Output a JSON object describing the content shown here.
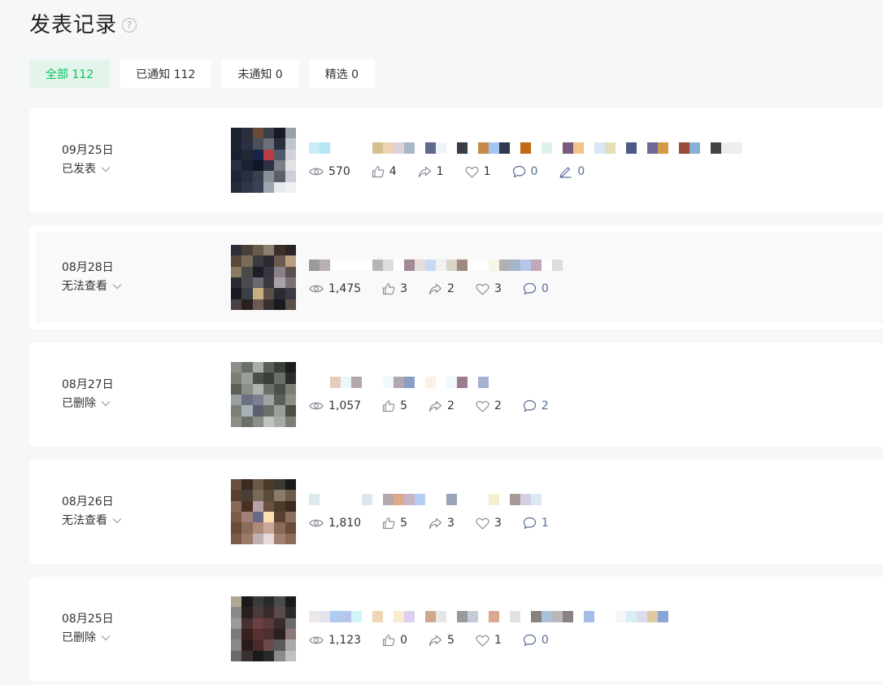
{
  "header": {
    "title": "发表记录",
    "help_glyph": "?"
  },
  "tabs": [
    {
      "label": "全部 112",
      "active": true
    },
    {
      "label": "已通知 112",
      "active": false
    },
    {
      "label": "未通知 0",
      "active": false
    },
    {
      "label": "精选 0",
      "active": false
    }
  ],
  "posts": [
    {
      "date": "09月25日",
      "status": "已发表",
      "stats": {
        "views": "570",
        "likes": "4",
        "shares": "1",
        "favorites": "1",
        "comments": "0",
        "notes": "0"
      },
      "thumb_colors": [
        "#1e2230",
        "#2a2f3c",
        "#6b4a3a",
        "#3a3f4a",
        "#151a24",
        "#9aa0aa",
        "#1e2230",
        "#2c3140",
        "#4a4f5a",
        "#6a6f7a",
        "#2a2f3c",
        "#c0c4cc",
        "#1b2030",
        "#232836",
        "#18214a",
        "#b83c40",
        "#505a6a",
        "#d0d4da",
        "#2a3040",
        "#1d2232",
        "#101528",
        "#2c3144",
        "#7a7f88",
        "#e0e2e6",
        "#20253a",
        "#2a2f40",
        "#3a3f50",
        "#8a8f98",
        "#5a5f6a",
        "#ccd0d6",
        "#262b38",
        "#30354a",
        "#3a4055",
        "#a0a5ae",
        "#e8eaee",
        "#f0f1f3"
      ],
      "title_colors": [
        "#c8eef7",
        "#b6e6f3",
        "#ffffff",
        "#ffffff",
        "#ffffff",
        "#ffffff",
        "#d6c08e",
        "#efd2b4",
        "#dcd2d8",
        "#a6b8c6",
        "#ffffff",
        "#5e6a8e",
        "#f1f4f6",
        "#ffffff",
        "#3a3d44",
        "#ffffff",
        "#c68a4a",
        "#a2c6f0",
        "#2d3a4f",
        "#ffffff",
        "#c06a16",
        "#ffffff",
        "#ddf1ea",
        "#ffffff",
        "#7a5a7e",
        "#f2c38a",
        "#ffffff",
        "#d6e8f7",
        "#e6dcb6",
        "#ffffff",
        "#4e5a86",
        "#ffffff",
        "#6e6a96",
        "#d39a48",
        "#ffffff",
        "#9a4a3a",
        "#8ab0d6",
        "#ffffff",
        "#444444",
        "#eeeeee",
        "#eeeeee"
      ]
    },
    {
      "date": "08月28日",
      "status": "无法查看",
      "stats": {
        "views": "1,475",
        "likes": "3",
        "shares": "2",
        "favorites": "3",
        "comments": "0"
      },
      "thumb_colors": [
        "#2b2f3a",
        "#4a3f3a",
        "#6a5a4a",
        "#8a7f72",
        "#3a2f2a",
        "#2a2428",
        "#5a4a3a",
        "#7a6a5a",
        "#3a3a42",
        "#2a2a30",
        "#6a5a50",
        "#b8a080",
        "#8a7a60",
        "#4a4a4a",
        "#1e1e24",
        "#3a3440",
        "#8a8088",
        "#5a5050",
        "#2a2a30",
        "#4a4a50",
        "#6a6a70",
        "#3a3a40",
        "#aaa0a8",
        "#7a7078",
        "#1a1a20",
        "#3a4048",
        "#c8b080",
        "#5a5048",
        "#2a2a30",
        "#3a3a40",
        "#4a4048",
        "#2a2020",
        "#6a5a52",
        "#3a3030",
        "#1a1a20",
        "#5a5048"
      ],
      "title_colors": [
        "#9a9a9a",
        "#b8b0b6",
        "#ffffff",
        "#ffffff",
        "#ffffff",
        "#ffffff",
        "#b6b6b6",
        "#dddddd",
        "#ffffff",
        "#a08a98",
        "#e6dcdc",
        "#c7daf3",
        "#f1f1f1",
        "#d8d4c8",
        "#a08a80",
        "#ffffff",
        "#ffffff",
        "#f7f5e4",
        "#b0b0b0",
        "#a6b6c8",
        "#b6c6ea",
        "#c0a8b8",
        "#ffffff",
        "#dcdcdc"
      ]
    },
    {
      "date": "08月27日",
      "status": "已删除",
      "stats": {
        "views": "1,057",
        "likes": "5",
        "shares": "2",
        "favorites": "2",
        "comments": "2"
      },
      "thumb_colors": [
        "#8a8f88",
        "#6a6f68",
        "#aaaeaa",
        "#5a5f58",
        "#3a3f38",
        "#1a1d18",
        "#7a7f78",
        "#9a9f98",
        "#4a4f48",
        "#3a4038",
        "#6a7068",
        "#2a2e28",
        "#5a5f58",
        "#8a8f88",
        "#b0b4b0",
        "#6a6f68",
        "#4a4f48",
        "#7a7f78",
        "#9aa0a0",
        "#6a7080",
        "#7a8090",
        "#a0a4a0",
        "#5a5f58",
        "#8a8f88",
        "#7a7f78",
        "#aab0b8",
        "#5a6070",
        "#6a6f68",
        "#9a9f98",
        "#4a4f48",
        "#8a8f88",
        "#6a6f68",
        "#8a8f88",
        "#c0c4c0",
        "#a8aca8",
        "#7a7f78"
      ],
      "title_colors": [
        "#ffffff",
        "#ffffff",
        "#e6cbbf",
        "#eaf8fa",
        "#b4a6ae",
        "#ffffff",
        "#ffffff",
        "#f0fafc",
        "#b0a8b4",
        "#8a9ec4",
        "#ffffff",
        "#fdf1e6",
        "#ffffff",
        "#eff8fa",
        "#a07a8e",
        "#ffffff",
        "#a6b0d2"
      ]
    },
    {
      "date": "08月26日",
      "status": "无法查看",
      "stats": {
        "views": "1,810",
        "likes": "5",
        "shares": "3",
        "favorites": "3",
        "comments": "1"
      },
      "thumb_colors": [
        "#6a5040",
        "#3a2a20",
        "#6a5a48",
        "#4a3a2a",
        "#3a3a30",
        "#1a1a18",
        "#5a4030",
        "#4a4038",
        "#7a6a58",
        "#5a4a3a",
        "#8a7a68",
        "#6a5a48",
        "#8a6a58",
        "#4a3020",
        "#b8a0a8",
        "#6a5040",
        "#4a3a2a",
        "#3a2a20",
        "#7a5a48",
        "#a08078",
        "#6a6888",
        "#fce0b0",
        "#5a4030",
        "#8a7060",
        "#6a4a38",
        "#8a6a58",
        "#b08a78",
        "#c8a898",
        "#8a6a58",
        "#6a4a38",
        "#7a5a48",
        "#9a7a68",
        "#c0b0b0",
        "#e8dada",
        "#a08070",
        "#8a6a58"
      ],
      "title_colors": [
        "#dceaf0",
        "#ffffff",
        "#ffffff",
        "#ffffff",
        "#ffffff",
        "#d9e8ef",
        "#ffffff",
        "#b6a6ae",
        "#dcaa8a",
        "#c4b6c6",
        "#b6cdf4",
        "#ffffff",
        "#ffffff",
        "#9aa6b8",
        "#ffffff",
        "#ffffff",
        "#ffffff",
        "#f7eed0",
        "#ffffff",
        "#a89a94",
        "#d4d0e4",
        "#dce8f6"
      ]
    },
    {
      "date": "08月25日",
      "status": "已删除",
      "stats": {
        "views": "1,123",
        "likes": "0",
        "shares": "5",
        "favorites": "1",
        "comments": "0"
      },
      "thumb_colors": [
        "#b0a890",
        "#1a1a1a",
        "#3a3a3a",
        "#2a2a2a",
        "#4a4a4a",
        "#1a1a1a",
        "#8a8a8a",
        "#2a2020",
        "#4a3a3a",
        "#3a2a2a",
        "#5a4a4a",
        "#2a2a2a",
        "#9a9a9a",
        "#4a3030",
        "#6a4040",
        "#5a3a3a",
        "#3a2a2a",
        "#6a6a6a",
        "#7a7a7a",
        "#3a2020",
        "#5a3030",
        "#4a3030",
        "#2a2020",
        "#8a7a7a",
        "#8a8a8a",
        "#2a1a1a",
        "#4a2a2a",
        "#6a4a4a",
        "#5a5a5a",
        "#aaaaaa",
        "#6a6a6a",
        "#3a3030",
        "#1a1a1a",
        "#2a2a2a",
        "#8a8a8a",
        "#c0c0c0"
      ],
      "title_colors": [
        "#ede6ea",
        "#e2e4ea",
        "#aecbf2",
        "#b6c6ea",
        "#d2f4f8",
        "#ffffff",
        "#eed6b6",
        "#ffffff",
        "#fcebce",
        "#dcd0f0",
        "#ffffff",
        "#d0a890",
        "#e6e6e6",
        "#ffffff",
        "#9a9a9a",
        "#c4ccd8",
        "#ffffff",
        "#d8a890",
        "#ffffff",
        "#e2e2e2",
        "#ffffff",
        "#8a8080",
        "#a8c0d8",
        "#b8b8b8",
        "#8a8080",
        "#ffffff",
        "#a6bce8",
        "#ffffff",
        "#ffffff",
        "#f4f6fa",
        "#d6eef4",
        "#dcdcee",
        "#e0c8a0",
        "#8aa6d6"
      ]
    }
  ]
}
